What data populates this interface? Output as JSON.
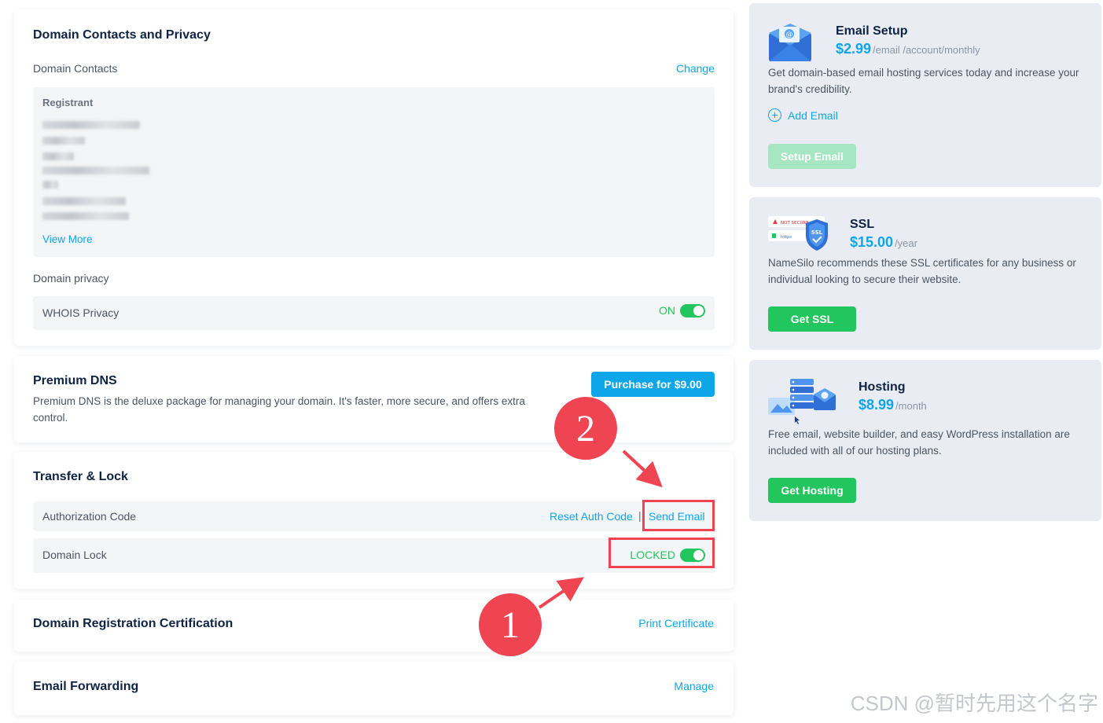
{
  "privacy": {
    "title": "Domain Contacts and Privacy",
    "contacts_label": "Domain Contacts",
    "change_link": "Change",
    "registrant_label": "Registrant",
    "view_more": "View More",
    "privacy_label": "Domain privacy",
    "whois_label": "WHOIS Privacy",
    "whois_status": "ON"
  },
  "premium_dns": {
    "title": "Premium DNS",
    "description": "Premium DNS is the deluxe package for managing your domain. It's faster, more secure, and offers extra control.",
    "purchase_button": "Purchase for $9.00"
  },
  "transfer": {
    "title": "Transfer & Lock",
    "auth_label": "Authorization Code",
    "reset_link": "Reset Auth Code",
    "separator": "|",
    "send_email_link": "Send Email",
    "lock_label": "Domain Lock",
    "lock_status": "LOCKED"
  },
  "certification": {
    "title": "Domain Registration Certification",
    "print_link": "Print Certificate"
  },
  "email_forwarding": {
    "title": "Email Forwarding",
    "manage_link": "Manage"
  },
  "sidebar": {
    "email": {
      "title": "Email Setup",
      "price": "$2.99",
      "unit": "/email /account/monthly",
      "description": "Get domain-based email hosting services today and increase your brand's credibility.",
      "add_email": "Add Email",
      "button": "Setup Email"
    },
    "ssl": {
      "title": "SSL",
      "price": "$15.00",
      "unit": "/year",
      "description": "NameSilo recommends these SSL certificates for any business or individual looking to secure their website.",
      "button": "Get SSL",
      "icon_not_secure": "NOT SECURE",
      "icon_https": "https",
      "icon_badge": "SSL"
    },
    "hosting": {
      "title": "Hosting",
      "price": "$8.99",
      "unit": "/month",
      "description": "Free email, website builder, and easy WordPress installation are included with all of our hosting plans.",
      "button": "Get Hosting"
    }
  },
  "annotations": {
    "badge_1": "1",
    "badge_2": "2",
    "color": "#ef4452"
  },
  "watermark": "CSDN @暂时先用这个名字"
}
